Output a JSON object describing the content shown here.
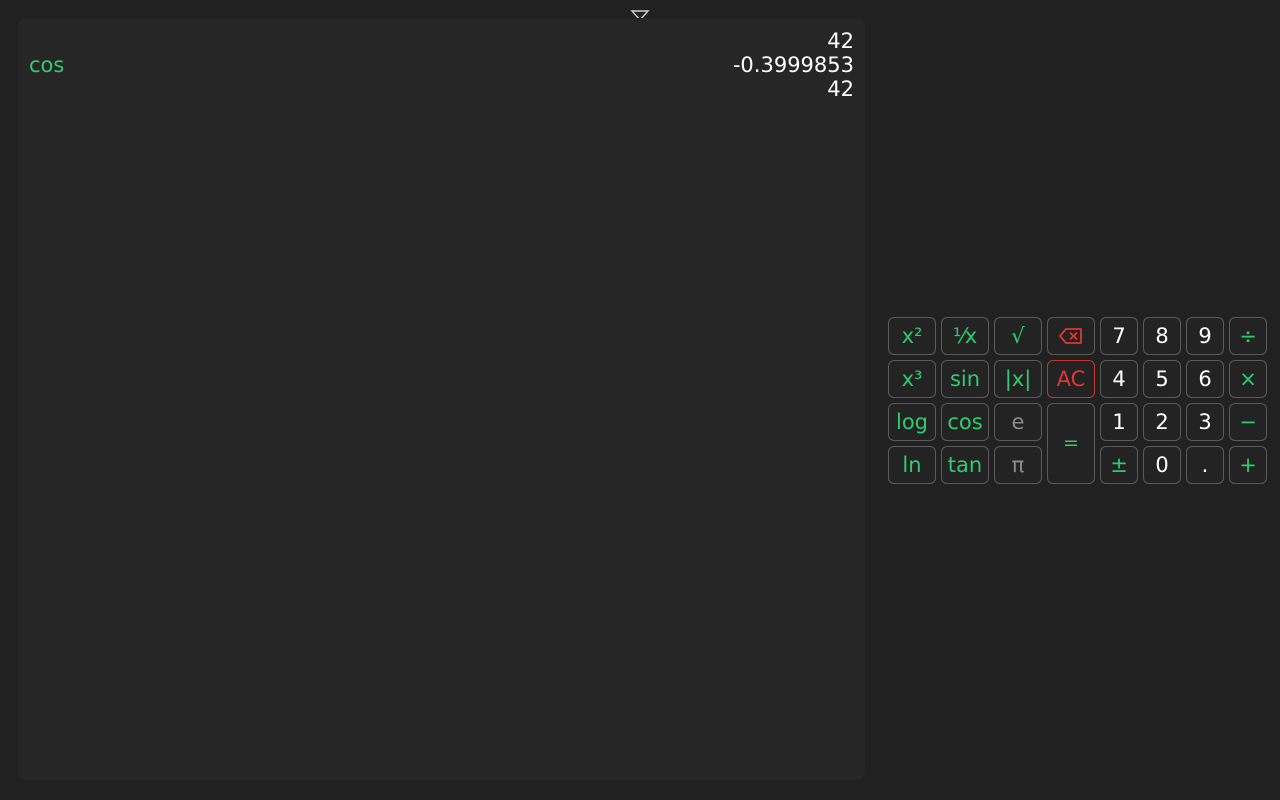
{
  "history": {
    "toggle_icon": "chevron-down-icon",
    "entries": [
      {
        "op": "",
        "value": "42"
      },
      {
        "op": "cos",
        "value": "-0.3999853"
      },
      {
        "op": "",
        "value": "42"
      }
    ]
  },
  "keypad": {
    "square": "x²",
    "reciprocal": "⅟x",
    "sqrt": "√",
    "backspace_icon": "backspace-icon",
    "cube": "x³",
    "sin": "sin",
    "abs": "|x|",
    "ac": "AC",
    "log": "log",
    "cos": "cos",
    "e": "e",
    "equals": "=",
    "ln": "ln",
    "tan": "tan",
    "pi": "π",
    "digits": {
      "7": "7",
      "8": "8",
      "9": "9",
      "4": "4",
      "5": "5",
      "6": "6",
      "1": "1",
      "2": "2",
      "3": "3",
      "0": "0"
    },
    "plus_minus": "±",
    "decimal": ".",
    "divide": "÷",
    "multiply": "×",
    "minus": "−",
    "plus": "+"
  },
  "colors": {
    "background": "#212121",
    "panel": "#262626",
    "accent": "#2ecc71",
    "danger": "#e03535",
    "muted": "#8a8a8a",
    "text": "#ffffff"
  }
}
